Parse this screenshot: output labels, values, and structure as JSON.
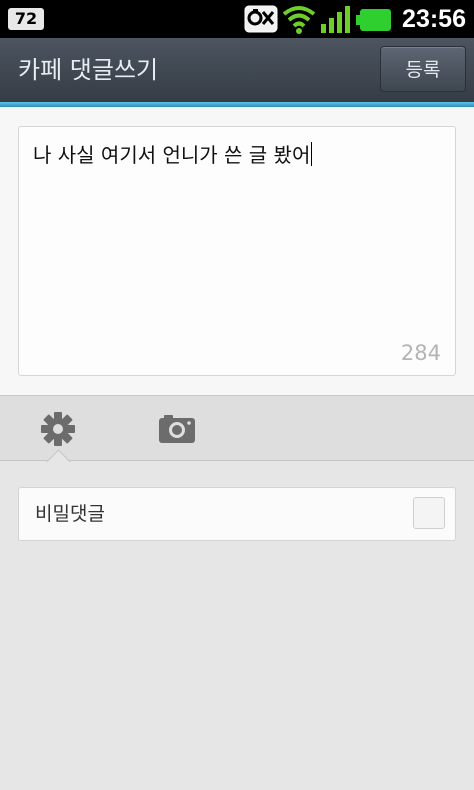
{
  "status_bar": {
    "notification_badge": "72",
    "clock": "23:56",
    "icons": [
      "notification-badge-icon",
      "sync-error-icon",
      "wifi-icon",
      "signal-icon",
      "battery-icon"
    ]
  },
  "header": {
    "title": "카페 댓글쓰기",
    "register_label": "등록"
  },
  "compose": {
    "text": "나 사실 여기서 언니가 쓴 글 봤어",
    "char_count": "284"
  },
  "tabs": {
    "items": [
      "gear-icon",
      "camera-icon"
    ],
    "selected": "gear-icon"
  },
  "options": {
    "secret_comment_label": "비밀댓글",
    "secret_comment_checked": false
  },
  "colors": {
    "accent": "#3aa8d4",
    "titlebar": "#3f4751",
    "battery": "#2fcf2f",
    "signal": "#6fcf2a"
  }
}
